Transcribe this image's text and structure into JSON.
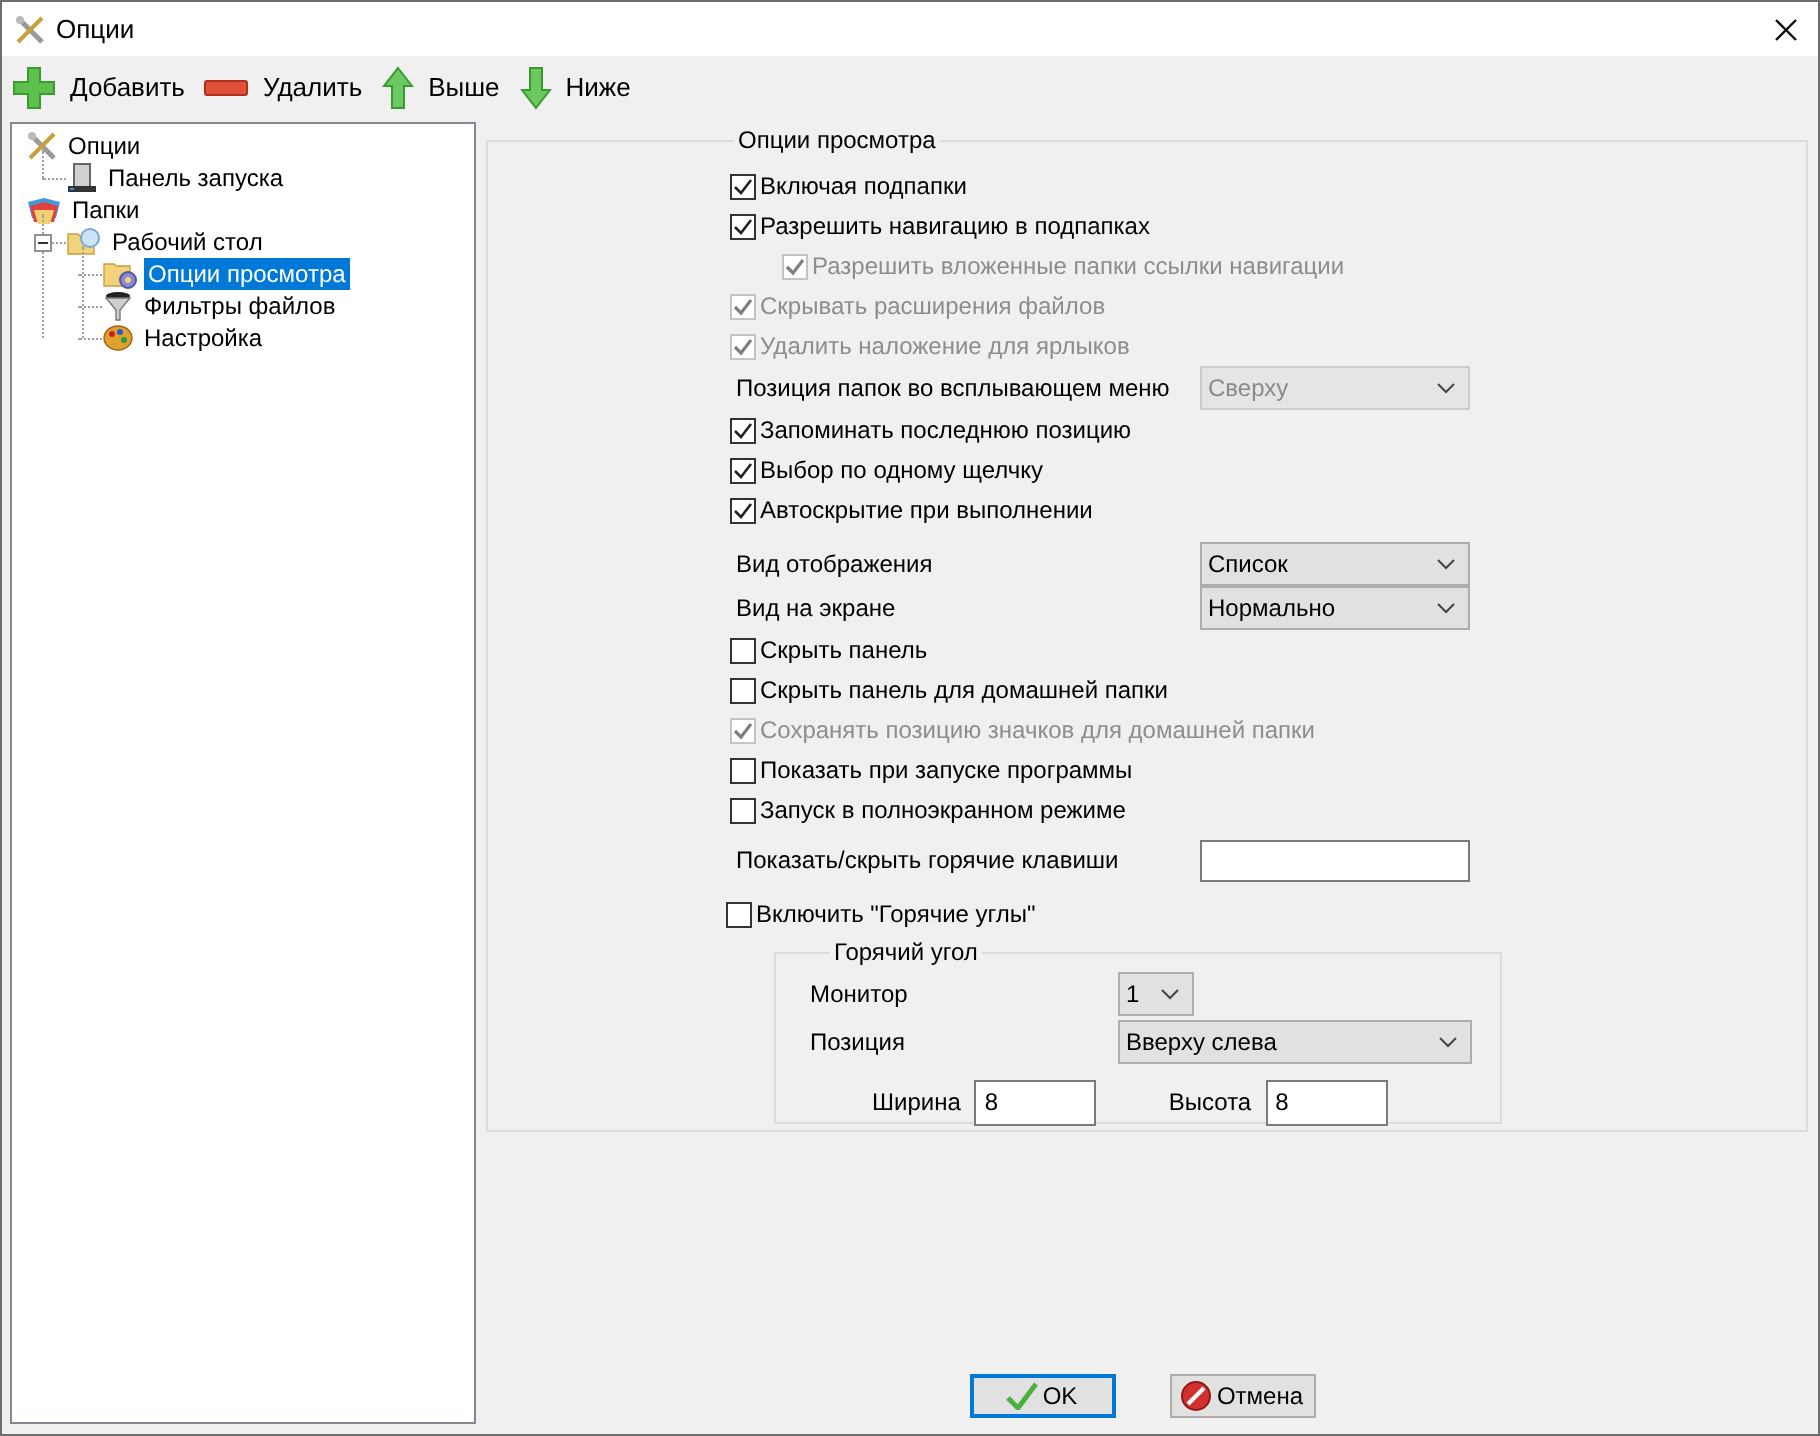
{
  "window": {
    "title": "Опции"
  },
  "toolbar": [
    {
      "label": "Добавить",
      "kind": "add"
    },
    {
      "label": "Удалить",
      "kind": "remove"
    },
    {
      "label": "Выше",
      "kind": "up"
    },
    {
      "label": "Ниже",
      "kind": "down"
    }
  ],
  "tree": [
    {
      "label": "Опции",
      "kind": "tools",
      "selected": false,
      "children": [
        {
          "label": "Панель запуска",
          "kind": "panel",
          "selected": false
        }
      ]
    },
    {
      "label": "Папки",
      "kind": "folders",
      "selected": false,
      "children": [
        {
          "label": "Рабочий стол",
          "kind": "desktop",
          "selected": false,
          "expanded": true,
          "children": [
            {
              "label": "Опции просмотра",
              "kind": "gearfolder",
              "selected": true
            },
            {
              "label": "Фильтры файлов",
              "kind": "funnel",
              "selected": false
            },
            {
              "label": "Настройка",
              "kind": "palette",
              "selected": false
            }
          ]
        }
      ]
    }
  ],
  "options": {
    "title": "Опции просмотра",
    "sections": [
      {
        "rows": [
          {
            "kind": "checkbox",
            "label": "Включая подпапки",
            "checked": true,
            "disabled": false
          },
          {
            "kind": "checkbox",
            "label": "Разрешить навигацию в подпапках",
            "checked": true,
            "disabled": false,
            "children": [
              {
                "kind": "checkbox",
                "label": "Разрешить вложенные папки ссылки навигации",
                "checked": true,
                "disabled": true
              }
            ]
          },
          {
            "kind": "checkbox",
            "label": "Скрывать расширения файлов",
            "checked": true,
            "disabled": true
          },
          {
            "kind": "checkbox",
            "label": "Удалить наложение для ярлыков",
            "checked": true,
            "disabled": true
          },
          {
            "kind": "select",
            "label": "Позиция папок во всплывающем меню",
            "value": "Сверху",
            "disabled": true
          },
          {
            "kind": "checkbox",
            "label": "Запоминать последнюю позицию",
            "checked": true,
            "disabled": false
          },
          {
            "kind": "checkbox",
            "label": "Выбор по одному щелчку",
            "checked": true,
            "disabled": false
          },
          {
            "kind": "checkbox",
            "label": "Автоскрытие при выполнении",
            "checked": true,
            "disabled": false
          }
        ]
      },
      {
        "rows": [
          {
            "kind": "select",
            "label": "Вид отображения",
            "value": "Список",
            "disabled": false
          },
          {
            "kind": "select",
            "label": "Вид на экране",
            "value": "Нормально",
            "disabled": false
          },
          {
            "kind": "checkbox",
            "label": "Скрыть панель",
            "checked": false,
            "disabled": false
          },
          {
            "kind": "checkbox",
            "label": "Скрыть панель для домашней папки",
            "checked": false,
            "disabled": false
          },
          {
            "kind": "checkbox",
            "label": "Сохранять позицию значков для домашней папки",
            "checked": true,
            "disabled": true
          },
          {
            "kind": "checkbox",
            "label": "Показать при запуске программы",
            "checked": false,
            "disabled": false
          },
          {
            "kind": "checkbox",
            "label": "Запуск в полноэкранном режиме",
            "checked": false,
            "disabled": false
          },
          {
            "kind": "field",
            "label": "Показать/скрыть горячие клавиши"
          }
        ]
      }
    ],
    "hot_corners": {
      "label": "Включить \"Горячие углы\"",
      "checked": false,
      "group": {
        "title": "Горячий угол",
        "monitor": {
          "label": "Монитор",
          "value": "1"
        },
        "position": {
          "label": "Позиция",
          "value": "Вверху слева"
        },
        "width": {
          "label": "Ширина",
          "value": "8"
        },
        "height": {
          "label": "Высота",
          "value": "8"
        }
      }
    }
  },
  "buttons": [
    {
      "label": "OK",
      "kind": "ok",
      "default": true
    },
    {
      "label": "Отмена",
      "kind": "cancel",
      "default": false
    }
  ]
}
